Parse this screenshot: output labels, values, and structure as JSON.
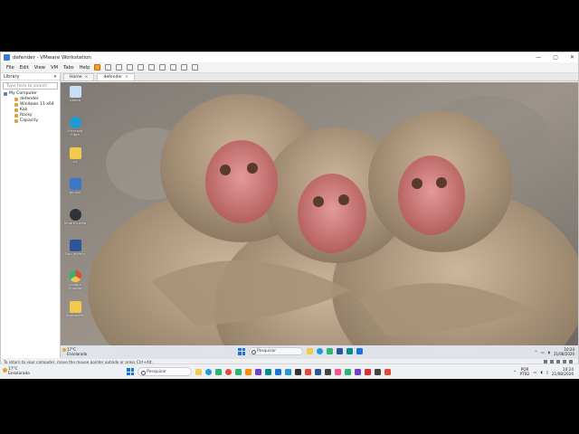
{
  "window": {
    "title": "defender - VMware Workstation",
    "controls": [
      "—",
      "▢",
      "✕"
    ]
  },
  "menu": {
    "items": [
      "File",
      "Edit",
      "View",
      "VM",
      "Tabs",
      "Help"
    ]
  },
  "library": {
    "title": "Library",
    "close": "×",
    "search_placeholder": "Type here to search",
    "root": "My Computer",
    "children": [
      "defender",
      "Windows 11 x64",
      "Kali",
      "Rocky",
      "Capacity"
    ]
  },
  "tabs": [
    {
      "label": "Home",
      "close": "×"
    },
    {
      "label": "defender",
      "close": "×"
    }
  ],
  "desktop_icons": [
    {
      "name": "recycle-bin-icon",
      "label": "Lixeira",
      "color": "#c9dff5"
    },
    {
      "name": "edge-icon",
      "label": "Microsoft Edge",
      "color": "#1f9ad6"
    },
    {
      "name": "folder-icon",
      "label": "a1",
      "color": "#f2c94c"
    },
    {
      "name": "app-icon",
      "label": "go.msi",
      "color": "#3c78c8"
    },
    {
      "name": "clock-icon",
      "label": "SmartScreen",
      "color": "#2f3338"
    },
    {
      "name": "word-icon",
      "label": "Documento",
      "color": "#2b579a"
    },
    {
      "name": "chrome-icon",
      "label": "Google Chrome",
      "color": "#e04a3a"
    },
    {
      "name": "notes-icon",
      "label": "anotações",
      "color": "#f2c94c"
    }
  ],
  "guest_taskbar": {
    "weather_temp": "17°C",
    "weather_desc": "Ensolarado",
    "search_placeholder": "Pesquisar",
    "time": "10:24",
    "date": "21/08/2026",
    "pinned_colors": [
      "#f2c94c",
      "#1f9ad6",
      "#2bb673",
      "#2b579a",
      "#0a8a8a",
      "#1a73d9"
    ]
  },
  "statusbar": {
    "text": "To return to your computer, move the mouse pointer outside or press Ctrl+Alt."
  },
  "host_taskbar": {
    "weather_temp": "17°C",
    "weather_desc": "Ensolarado",
    "search_placeholder": "Pesquisar",
    "lang": "POR",
    "lang_sub": "PTB2",
    "time": "10:24",
    "date": "21/08/2026",
    "pinned_colors": [
      "#f2c94c",
      "#1f9ad6",
      "#2bb673",
      "#e04a3a",
      "#2bb673",
      "#ff8a00",
      "#6f42c1",
      "#0a8a8a",
      "#1a73d9",
      "#1f9ad6",
      "#333333",
      "#e04a3a",
      "#2b579a",
      "#444444",
      "#ff4f8b",
      "#2bb673",
      "#6f42c1",
      "#d93030",
      "#444444",
      "#e04a3a"
    ]
  }
}
